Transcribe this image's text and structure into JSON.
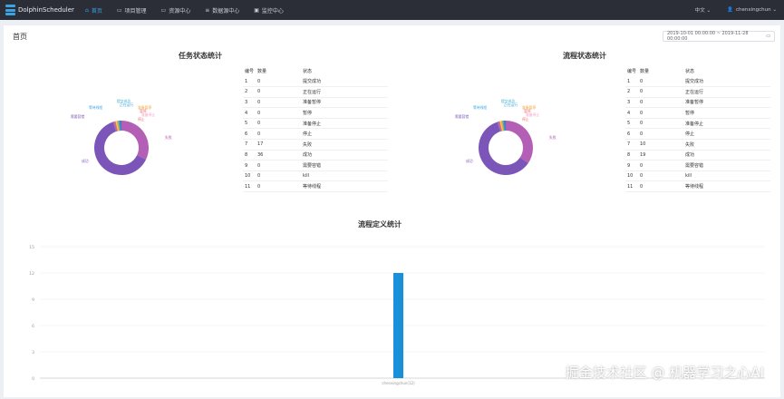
{
  "app": {
    "name": "DolphinScheduler"
  },
  "nav": [
    {
      "label": "首页",
      "icon": "home-icon",
      "active": true
    },
    {
      "label": "项目管理",
      "icon": "folder-icon",
      "active": false
    },
    {
      "label": "资源中心",
      "icon": "folder-icon",
      "active": false
    },
    {
      "label": "数据源中心",
      "icon": "database-icon",
      "active": false
    },
    {
      "label": "监控中心",
      "icon": "monitor-icon",
      "active": false
    }
  ],
  "header": {
    "language": "中文",
    "username": "chenxingchun"
  },
  "page": {
    "title": "首页",
    "date_range": "2019-10-01 00:00:00 ~ 2019-11-28 00:00:00"
  },
  "task_stats": {
    "title": "任务状态统计",
    "columns": [
      "编号",
      "数量",
      "状态"
    ],
    "rows": [
      [
        "1",
        "0",
        "提交成功"
      ],
      [
        "2",
        "0",
        "正在运行"
      ],
      [
        "3",
        "0",
        "准备暂停"
      ],
      [
        "4",
        "0",
        "暂停"
      ],
      [
        "5",
        "0",
        "准备停止"
      ],
      [
        "6",
        "0",
        "停止"
      ],
      [
        "7",
        "17",
        "失败"
      ],
      [
        "8",
        "36",
        "成功"
      ],
      [
        "9",
        "0",
        "需要容错"
      ],
      [
        "10",
        "0",
        "kill"
      ],
      [
        "11",
        "0",
        "等待线程"
      ]
    ],
    "pie_labels": [
      "提交成功",
      "正在运行",
      "准备暂停",
      "暂停",
      "准备停止",
      "停止",
      "失败",
      "成功",
      "需要容错",
      "等待线程"
    ]
  },
  "process_stats": {
    "title": "流程状态统计",
    "columns": [
      "编号",
      "数量",
      "状态"
    ],
    "rows": [
      [
        "1",
        "0",
        "提交成功"
      ],
      [
        "2",
        "0",
        "正在运行"
      ],
      [
        "3",
        "0",
        "准备暂停"
      ],
      [
        "4",
        "0",
        "暂停"
      ],
      [
        "5",
        "0",
        "准备停止"
      ],
      [
        "6",
        "0",
        "停止"
      ],
      [
        "7",
        "10",
        "失败"
      ],
      [
        "8",
        "19",
        "成功"
      ],
      [
        "9",
        "0",
        "需要容错"
      ],
      [
        "10",
        "0",
        "kill"
      ],
      [
        "11",
        "0",
        "等待线程"
      ]
    ],
    "pie_labels": [
      "提交成功",
      "正在运行",
      "准备暂停",
      "暂停",
      "准备停止",
      "停止",
      "失败",
      "成功",
      "需要容错",
      "等待线程"
    ]
  },
  "definition_stats": {
    "title": "流程定义统计"
  },
  "chart_data": [
    {
      "type": "pie",
      "title": "任务状态统计",
      "categories": [
        "失败",
        "成功"
      ],
      "values": [
        17,
        36
      ],
      "colors": [
        "#b35fb5",
        "#7b55b8"
      ]
    },
    {
      "type": "pie",
      "title": "流程状态统计",
      "categories": [
        "失败",
        "成功"
      ],
      "values": [
        10,
        19
      ],
      "colors": [
        "#b35fb5",
        "#7b55b8"
      ]
    },
    {
      "type": "bar",
      "title": "流程定义统计",
      "categories": [
        "chenxingchun(12)"
      ],
      "values": [
        12
      ],
      "yticks": [
        "0",
        "3",
        "6",
        "9",
        "12",
        "15"
      ],
      "ylim": [
        0,
        15
      ],
      "color": "#1a90d8"
    }
  ],
  "watermark": "掘金技术社区 @ 机器学习之心AI",
  "colors": {
    "topbar": "#2b2e37",
    "accent": "#3aa3e3"
  }
}
